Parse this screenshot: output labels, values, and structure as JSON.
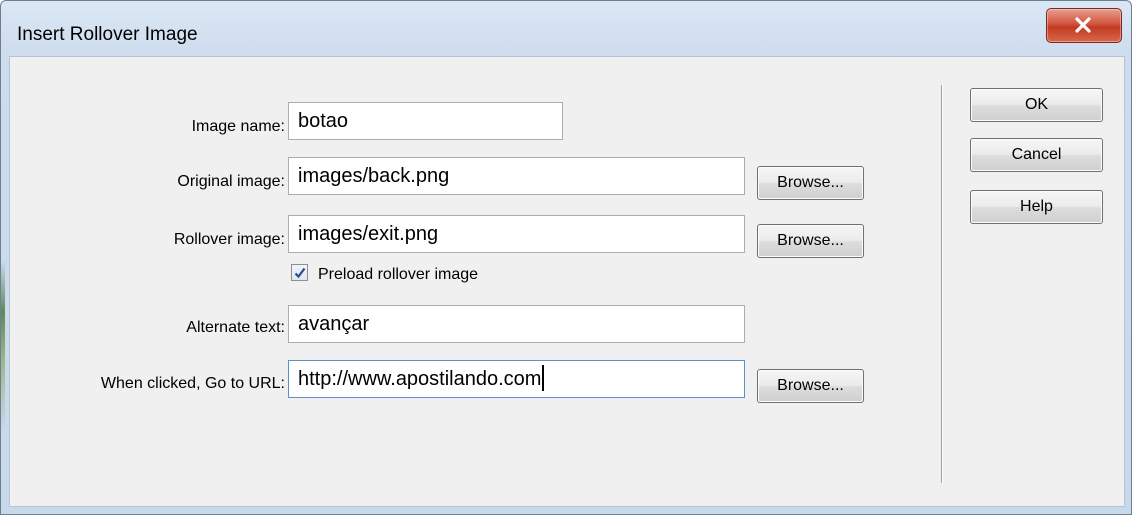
{
  "window": {
    "title": "Insert Rollover Image"
  },
  "form": {
    "image_name": {
      "label": "Image name:",
      "value": "botao"
    },
    "original_image": {
      "label": "Original image:",
      "value": "images/back.png",
      "browse": "Browse..."
    },
    "rollover_image": {
      "label": "Rollover image:",
      "value": "images/exit.png",
      "browse": "Browse..."
    },
    "preload": {
      "label": "Preload rollover image",
      "checked": true
    },
    "alternate_text": {
      "label": "Alternate text:",
      "value": "avançar"
    },
    "go_to_url": {
      "label": "When clicked, Go to URL:",
      "value": "http://www.apostilando.com",
      "browse": "Browse..."
    }
  },
  "buttons": {
    "ok": "OK",
    "cancel": "Cancel",
    "help": "Help"
  },
  "icons": {
    "close": "close-icon",
    "check": "checkmark-icon"
  }
}
